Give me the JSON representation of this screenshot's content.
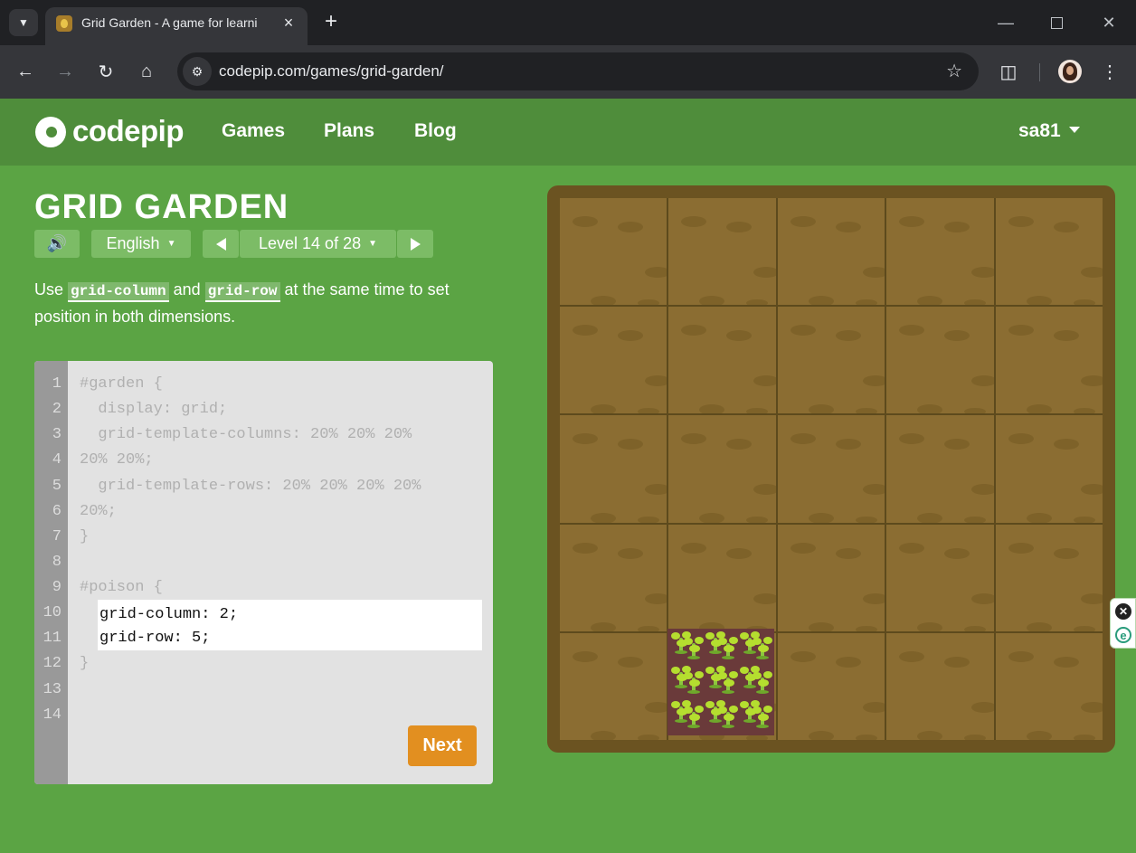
{
  "browser": {
    "tab_title": "Grid Garden - A game for learni",
    "url": "codepip.com/games/grid-garden/"
  },
  "site": {
    "logo_text": "codepip",
    "nav": [
      "Games",
      "Plans",
      "Blog"
    ],
    "user": "sa81",
    "brand_color": "#5ba444"
  },
  "game": {
    "title": "GRID GARDEN",
    "language": "English",
    "level": "Level 14 of 28",
    "instructions": {
      "before": "Use ",
      "code1": "grid-column",
      "middle": " and ",
      "code2": "grid-row",
      "after": " at the same time to set position in both dimensions."
    },
    "line_numbers": [
      "1",
      "2",
      "3",
      "4",
      "5",
      "6",
      "7",
      "8",
      "9",
      "10",
      "11",
      "12",
      "13",
      "14"
    ],
    "code_lines": [
      "#garden {",
      "  display: grid;",
      "  grid-template-columns: 20% 20% 20%",
      "20% 20%;",
      "  grid-template-rows: 20% 20% 20% 20%",
      "20%;",
      "}",
      "",
      "#poison {",
      "",
      "",
      "}",
      "",
      ""
    ],
    "input_value": "grid-column: 2;\ngrid-row: 5;",
    "next_label": "Next",
    "poison_column": 2,
    "poison_row": 5
  }
}
